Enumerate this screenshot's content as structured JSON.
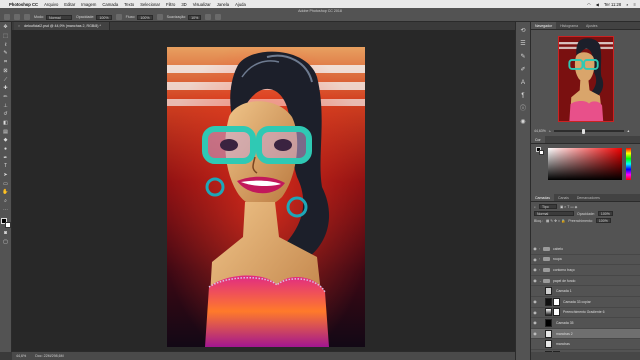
{
  "menubar": {
    "app_name": "Photoshop CC",
    "items": [
      "Arquivo",
      "Editar",
      "Imagem",
      "Camada",
      "Texto",
      "Selecionar",
      "Filtro",
      "3D",
      "Visualizar",
      "Janela",
      "Ajuda"
    ],
    "clock": "Ter 11:28"
  },
  "options_bar": {
    "window_title": "Adobe Photoshop CC 2018",
    "mode_label": "Modo:",
    "mode_value": "Normal",
    "opacity_label": "Opacidade:",
    "opacity_value": "100%",
    "flow_label": "Fluxo:",
    "flow_value": "100%",
    "smoothing_label": "Suavização:",
    "smoothing_value": "10%"
  },
  "document_tab": {
    "title": "delouficial2.psd @ 44,9% (manchas 2, RGB/8) *"
  },
  "status_bar": {
    "zoom": "44,6%",
    "doc_info": "Doc: 22M/298,6M"
  },
  "panels": {
    "navigator_tabs": [
      "Navegador",
      "Histograma",
      "Ajustes"
    ],
    "navigator_zoom": "44,63%",
    "color_tab": "Cor",
    "layers_tabs": [
      "Camadas",
      "Canais",
      "Demarcadores"
    ],
    "kind_label": "Tipo",
    "blend_mode": "Normal",
    "opacity_label": "Opacidade:",
    "opacity_value": "100%",
    "lock_label": "Bloq.:",
    "fill_label": "Preenchimento:",
    "fill_value": "100%",
    "layers": [
      {
        "name": "cabelo",
        "type": "group"
      },
      {
        "name": "roupa",
        "type": "group"
      },
      {
        "name": "contorno traço",
        "type": "group"
      },
      {
        "name": "papel de fundo",
        "type": "group"
      },
      {
        "name": "Camada 1",
        "type": "layer"
      },
      {
        "name": "Camada 33 copiar",
        "type": "layer"
      },
      {
        "name": "Preenchimento Gradiente 6",
        "type": "layer"
      },
      {
        "name": "Camada 35",
        "type": "layer"
      },
      {
        "name": "manchas 2",
        "type": "layer",
        "selected": true
      },
      {
        "name": "manchas",
        "type": "layer"
      },
      {
        "name": "Preenchimento... cores 1 copiar",
        "type": "layer"
      }
    ]
  },
  "colors": {
    "accent_red": "#d81f26",
    "glasses_teal": "#2fc9b4",
    "skin": "#d9a56b"
  }
}
